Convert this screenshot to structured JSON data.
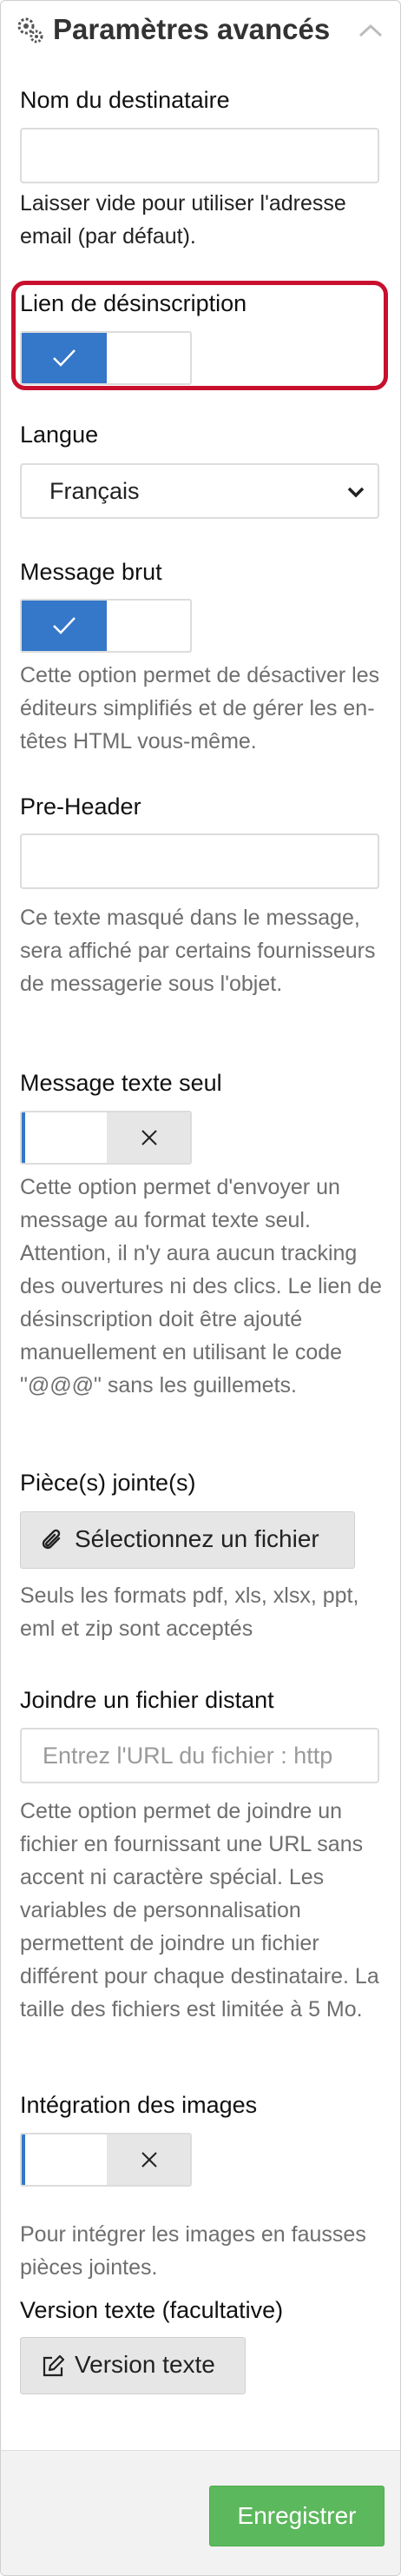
{
  "header": {
    "title": "Paramètres avancés",
    "icon": "gears-icon",
    "collapse_icon": "chevron-up-icon"
  },
  "fields": {
    "recipient_name": {
      "label": "Nom du destinataire",
      "value": "",
      "help": "Laisser vide pour utiliser l'adresse email (par défaut)."
    },
    "unsubscribe_link": {
      "label": "Lien de désinscription",
      "checked": true
    },
    "language": {
      "label": "Langue",
      "selected": "Français"
    },
    "raw_message": {
      "label": "Message brut",
      "checked": true,
      "help": "Cette option permet de désactiver les éditeurs simplifiés et de gérer les en-têtes HTML vous-même."
    },
    "pre_header": {
      "label": "Pre-Header",
      "value": "",
      "help": "Ce texte masqué dans le message, sera affiché par certains fournisseurs de messagerie sous l'objet."
    },
    "text_only": {
      "label": "Message texte seul",
      "checked": false,
      "help": "Cette option permet d'envoyer un message au format texte seul. Attention, il n'y aura aucun tracking des ouvertures ni des clics. Le lien de désinscription doit être ajouté manuellement en utilisant le code \"@@@\" sans les guillemets."
    },
    "attachments": {
      "label": "Pièce(s) jointe(s)",
      "button_label": "Sélectionnez un fichier",
      "help": "Seuls les formats pdf, xls, xlsx, ppt, eml et zip sont acceptés"
    },
    "remote_file": {
      "label": "Joindre un fichier distant",
      "placeholder": "Entrez l'URL du fichier : http",
      "help": "Cette option permet de joindre un fichier en fournissant une URL sans accent ni caractère spécial. Les variables de personnalisation permettent de joindre un fichier différent pour chaque destinataire. La taille des fichiers est limitée à 5 Mo."
    },
    "image_integration": {
      "label": "Intégration des images",
      "checked": false,
      "help": "Pour intégrer les images en fausses pièces jointes."
    },
    "text_version": {
      "label": "Version texte (facultative)",
      "button_label": "Version texte"
    }
  },
  "footer": {
    "save_label": "Enregistrer"
  },
  "colors": {
    "toggle_on": "#3577c8",
    "highlight": "#c8102e",
    "save": "#5cb85c"
  }
}
